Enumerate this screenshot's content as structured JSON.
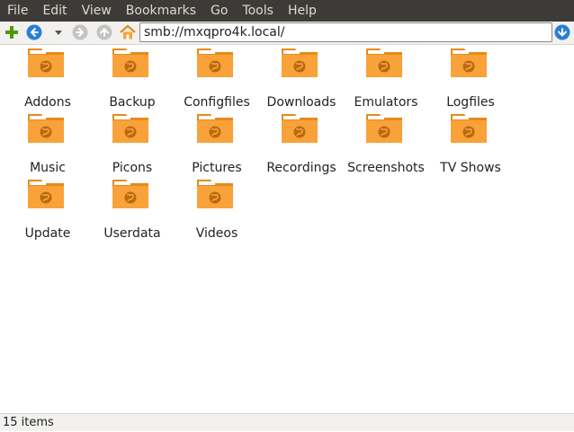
{
  "menu": [
    "File",
    "Edit",
    "View",
    "Bookmarks",
    "Go",
    "Tools",
    "Help"
  ],
  "toolbar": {
    "address": "smb://mxqpro4k.local/"
  },
  "folders": [
    "Addons",
    "Backup",
    "Configfiles",
    "Downloads",
    "Emulators",
    "Logfiles",
    "Music",
    "Picons",
    "Pictures",
    "Recordings",
    "Screenshots",
    "TV Shows",
    "Update",
    "Userdata",
    "Videos"
  ],
  "status": "15 items",
  "colors": {
    "menubar": "#3c3b37",
    "folder_body": "#f9a23a",
    "folder_tab": "#e88a1a",
    "accent_blue": "#2a7fd4",
    "add_green": "#4e9a06"
  }
}
